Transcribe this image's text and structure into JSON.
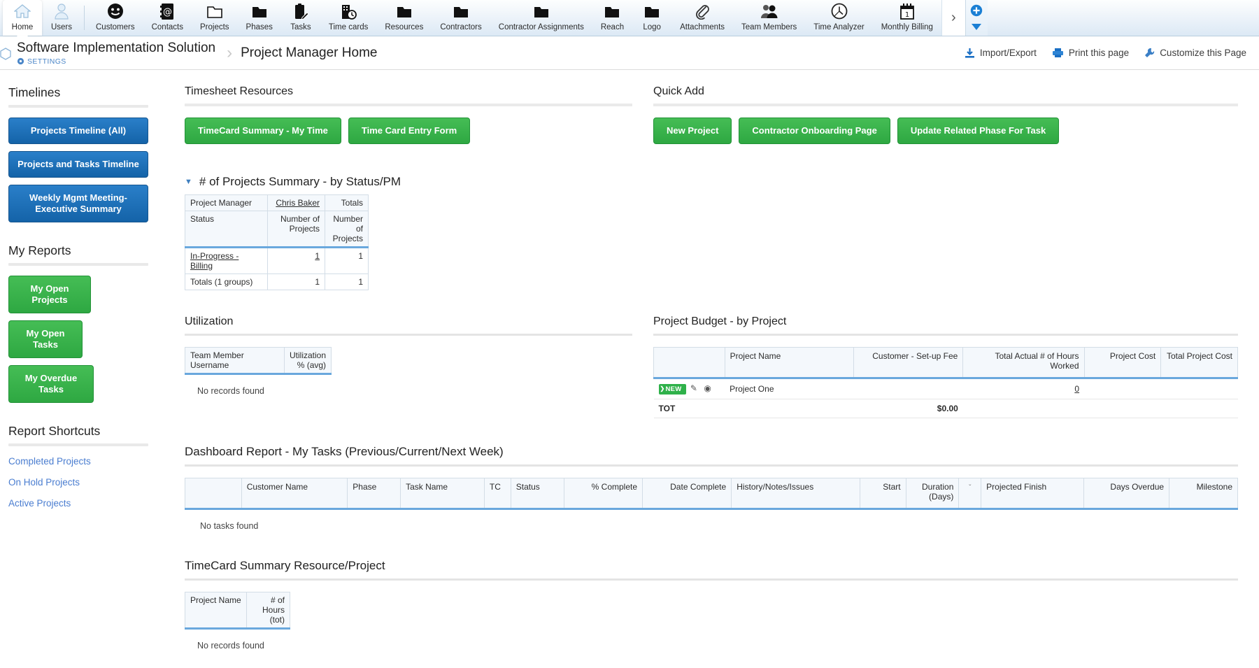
{
  "topnav": {
    "items": [
      {
        "label": "Home",
        "icon": "home-icon",
        "active": true
      },
      {
        "label": "Users",
        "icon": "user-icon",
        "active": false
      },
      {
        "label": "Customers",
        "icon": "smiley-icon",
        "active": false
      },
      {
        "label": "Contacts",
        "icon": "at-book-icon",
        "active": false
      },
      {
        "label": "Projects",
        "icon": "folder-open-icon",
        "active": false
      },
      {
        "label": "Phases",
        "icon": "folder-icon",
        "active": false
      },
      {
        "label": "Tasks",
        "icon": "clipboard-pencil-icon",
        "active": false
      },
      {
        "label": "Time cards",
        "icon": "building-clock-icon",
        "active": false
      },
      {
        "label": "Resources",
        "icon": "folder-icon",
        "active": false
      },
      {
        "label": "Contractors",
        "icon": "folder-icon",
        "active": false
      },
      {
        "label": "Contractor Assignments",
        "icon": "folder-icon",
        "active": false
      },
      {
        "label": "Reach",
        "icon": "folder-icon",
        "active": false
      },
      {
        "label": "Logo",
        "icon": "folder-icon",
        "active": false
      },
      {
        "label": "Attachments",
        "icon": "paperclip-icon",
        "active": false
      },
      {
        "label": "Team Members",
        "icon": "people-icon",
        "active": false
      },
      {
        "label": "Time Analyzer",
        "icon": "clock-icon",
        "active": false
      },
      {
        "label": "Monthly Billing",
        "icon": "calendar-icon",
        "active": false
      }
    ],
    "more_label": "›",
    "add_label": "+",
    "dropdown_label": "▼"
  },
  "header": {
    "app_title": "Software Implementation Solution",
    "settings_label": "SETTINGS",
    "separator": "›",
    "page_title": "Project Manager Home",
    "actions": [
      {
        "label": "Import/Export",
        "icon": "import-export-icon"
      },
      {
        "label": "Print this page",
        "icon": "printer-icon"
      },
      {
        "label": "Customize this Page",
        "icon": "wrench-icon"
      }
    ]
  },
  "sidebar": {
    "timelines": {
      "title": "Timelines",
      "buttons": [
        "Projects Timeline (All)",
        "Projects and Tasks Timeline",
        "Weekly Mgmt Meeting-\nExecutive Summary"
      ]
    },
    "my_reports": {
      "title": "My Reports",
      "buttons": [
        "My Open Projects",
        "My Open Tasks",
        "My Overdue Tasks"
      ]
    },
    "report_shortcuts": {
      "title": "Report Shortcuts",
      "links": [
        "Completed Projects",
        "On Hold Projects",
        "Active Projects"
      ]
    }
  },
  "timesheet_resources": {
    "title": "Timesheet Resources",
    "buttons": [
      "TimeCard Summary - My Time",
      "Time Card Entry Form"
    ]
  },
  "quick_add": {
    "title": "Quick Add",
    "buttons": [
      "New Project",
      "Contractor Onboarding Page",
      "Update Related Phase For Task"
    ]
  },
  "projects_summary": {
    "title": "# of Projects Summary - by Status/PM",
    "toggle": "▼",
    "header_row1": [
      "Project Manager",
      "Chris Baker",
      "Totals"
    ],
    "header_row2": [
      "Status",
      "Number of Projects",
      "Number of Projects"
    ],
    "rows": [
      {
        "status": "In-Progress - Billing",
        "chris_baker": "1",
        "totals": "1",
        "link": true
      },
      {
        "status": "Totals (1 groups)",
        "chris_baker": "1",
        "totals": "1",
        "link": false
      }
    ]
  },
  "utilization": {
    "title": "Utilization",
    "columns": [
      "Team Member Username",
      "Utilization % (avg)"
    ],
    "empty_message": "No records found"
  },
  "project_budget": {
    "title": "Project Budget - by Project",
    "columns": [
      "",
      "Project Name",
      "Customer - Set-up Fee",
      "Total Actual # of Hours Worked",
      "Project Cost",
      "Total Project Cost"
    ],
    "rows": [
      {
        "badge": "NEW",
        "edit_icon": "pencil-icon",
        "view_icon": "eye-icon",
        "project_name": "Project One",
        "setup_fee": "",
        "hours_worked": "0",
        "project_cost": "",
        "total_project_cost": ""
      }
    ],
    "total_row": {
      "label": "TOT",
      "setup_fee": "$0.00",
      "hours_worked": "",
      "project_cost": "",
      "total_project_cost": ""
    }
  },
  "dashboard_report": {
    "title": "Dashboard Report - My Tasks (Previous/Current/Next Week)",
    "columns": [
      "",
      "Customer Name",
      "Phase",
      "Task Name",
      "TC",
      "Status",
      "% Complete",
      "Date Complete",
      "History/Notes/Issues",
      "Start",
      "Duration (Days)",
      "",
      "Projected Finish",
      "Days Overdue",
      "Milestone"
    ],
    "sort_caret": "ˇ",
    "empty_message": "No tasks found"
  },
  "timecard_summary": {
    "title": "TimeCard Summary Resource/Project",
    "columns": [
      "Project Name",
      "# of Hours (tot)"
    ],
    "empty_message": "No records found"
  }
}
